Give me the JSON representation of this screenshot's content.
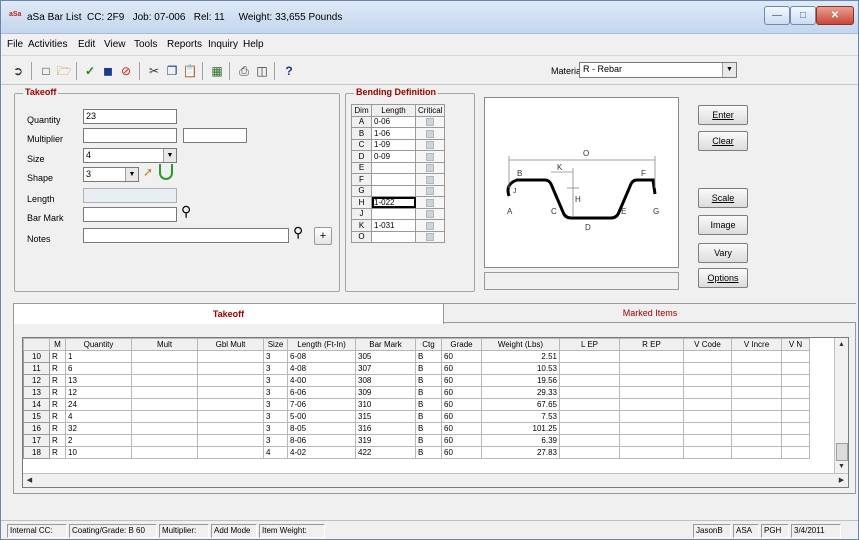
{
  "window": {
    "title": "aSa Bar List  CC: 2F9   Job: 07-006   Rel: 11     Weight: 33,655 Pounds",
    "icon_label": "aSa"
  },
  "menu": [
    "File",
    "Activities",
    "Edit",
    "View",
    "Tools",
    "Reports",
    "Inquiry",
    "Help"
  ],
  "toolbar": {
    "material_label": "Material",
    "material_value": "R - Rebar"
  },
  "takeoff": {
    "title": "Takeoff",
    "quantity_label": "Quantity",
    "quantity_value": "23",
    "multiplier_label": "Multiplier",
    "multiplier_value": "",
    "multiplier_value2": "",
    "size_label": "Size",
    "size_value": "4",
    "shape_label": "Shape",
    "shape_value": "3",
    "length_label": "Length",
    "length_value": "",
    "barmark_label": "Bar Mark",
    "barmark_value": "",
    "notes_label": "Notes",
    "notes_value": "",
    "plus_label": "+"
  },
  "bending": {
    "title": "Bending Definition",
    "headers": [
      "Dim",
      "Length",
      "Critical"
    ],
    "rows": [
      {
        "dim": "A",
        "len": "0-06"
      },
      {
        "dim": "B",
        "len": "1-06"
      },
      {
        "dim": "C",
        "len": "1-09"
      },
      {
        "dim": "D",
        "len": "0-09"
      },
      {
        "dim": "E",
        "len": ""
      },
      {
        "dim": "F",
        "len": ""
      },
      {
        "dim": "G",
        "len": ""
      },
      {
        "dim": "H",
        "len": "1-022"
      },
      {
        "dim": "J",
        "len": ""
      },
      {
        "dim": "K",
        "len": "1-031"
      },
      {
        "dim": "O",
        "len": ""
      }
    ]
  },
  "shape_labels": {
    "O": "O",
    "B": "B",
    "K": "K",
    "J": "J",
    "H": "H",
    "F": "F",
    "A": "A",
    "C": "C",
    "D": "D",
    "E": "E",
    "G": "G"
  },
  "buttons": {
    "enter": "Enter",
    "clear": "Clear",
    "scale": "Scale",
    "image": "Image",
    "vary": "Vary",
    "options": "Options"
  },
  "tabs": {
    "takeoff": "Takeoff",
    "marked": "Marked Items"
  },
  "grid": {
    "headers": [
      "",
      "M",
      "Quantity",
      "Mult",
      "Gbl Mult",
      "Size",
      "Length (Ft-In)",
      "Bar Mark",
      "Ctg",
      "Grade",
      "Weight (Lbs)",
      "L EP",
      "R EP",
      "V Code",
      "V Incre",
      "V N"
    ],
    "rows": [
      {
        "n": "10",
        "m": "R",
        "qty": "1",
        "size": "3",
        "len": "6-08",
        "mark": "305",
        "ctg": "B",
        "grade": "60",
        "wt": "2.51"
      },
      {
        "n": "11",
        "m": "R",
        "qty": "6",
        "size": "3",
        "len": "4-08",
        "mark": "307",
        "ctg": "B",
        "grade": "60",
        "wt": "10.53"
      },
      {
        "n": "12",
        "m": "R",
        "qty": "13",
        "size": "3",
        "len": "4-00",
        "mark": "308",
        "ctg": "B",
        "grade": "60",
        "wt": "19.56"
      },
      {
        "n": "13",
        "m": "R",
        "qty": "12",
        "size": "3",
        "len": "6-06",
        "mark": "309",
        "ctg": "B",
        "grade": "60",
        "wt": "29.33"
      },
      {
        "n": "14",
        "m": "R",
        "qty": "24",
        "size": "3",
        "len": "7-06",
        "mark": "310",
        "ctg": "B",
        "grade": "60",
        "wt": "67.65"
      },
      {
        "n": "15",
        "m": "R",
        "qty": "4",
        "size": "3",
        "len": "5-00",
        "mark": "315",
        "ctg": "B",
        "grade": "60",
        "wt": "7.53"
      },
      {
        "n": "16",
        "m": "R",
        "qty": "32",
        "size": "3",
        "len": "8-05",
        "mark": "316",
        "ctg": "B",
        "grade": "60",
        "wt": "101.25"
      },
      {
        "n": "17",
        "m": "R",
        "qty": "2",
        "size": "3",
        "len": "8-06",
        "mark": "319",
        "ctg": "B",
        "grade": "60",
        "wt": "6.39"
      },
      {
        "n": "18",
        "m": "R",
        "qty": "10",
        "size": "4",
        "len": "4-02",
        "mark": "422",
        "ctg": "B",
        "grade": "60",
        "wt": "27.83"
      }
    ]
  },
  "status": [
    "Internal CC:",
    "Coating/Grade: B 60",
    "Multiplier:",
    "Add Mode",
    "Item Weight:",
    "JasonB",
    "ASA",
    "PGH",
    "3/4/2011"
  ],
  "colors": {
    "accent_red": "#a00000",
    "title_bar": "#c3d6ee"
  }
}
